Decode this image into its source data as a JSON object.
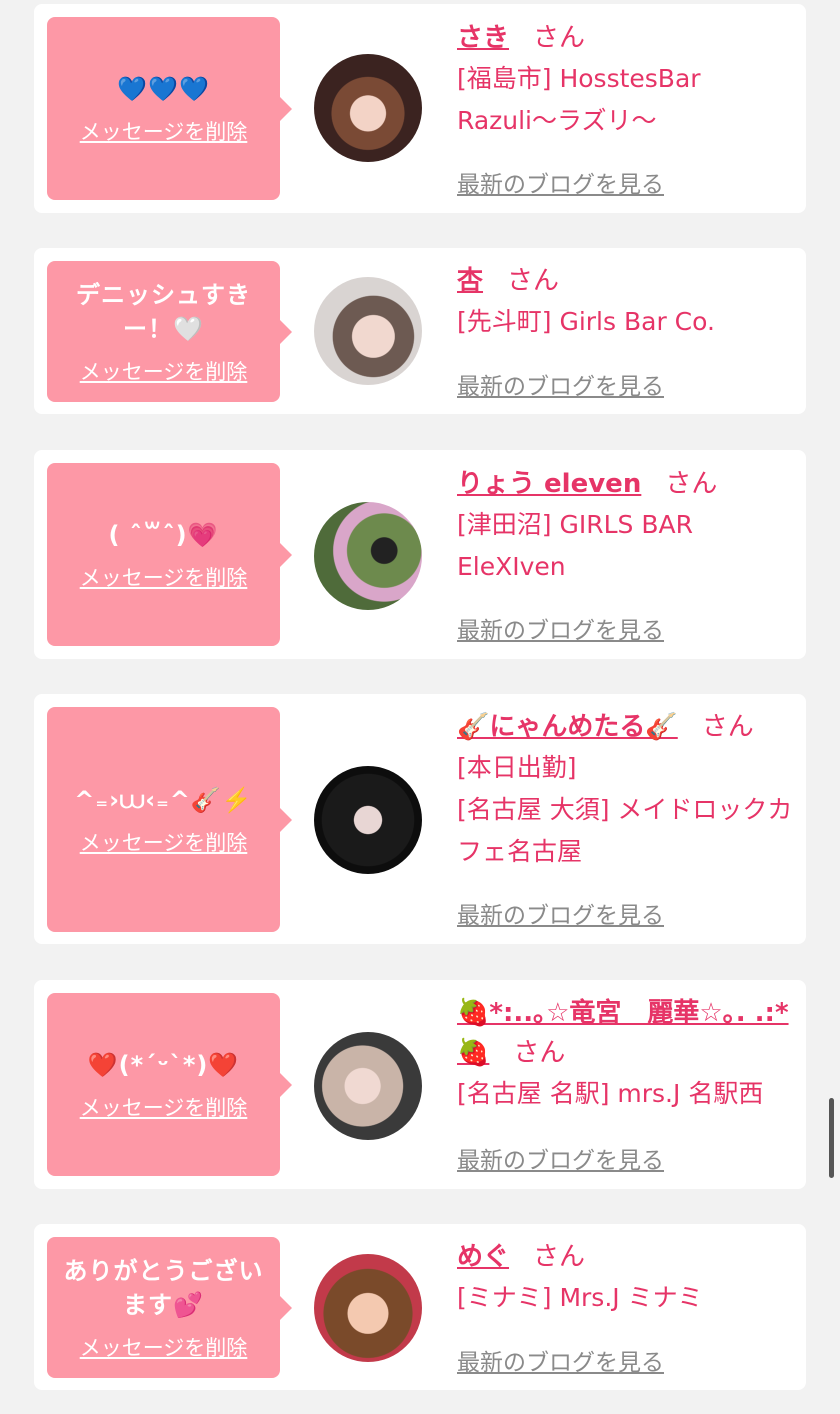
{
  "cards": [
    {
      "message": "💙💙💙",
      "delete_label": "メッセージを削除",
      "name": "さき",
      "san": "さん",
      "shop": "[福島市] HosstesBar Razuli〜ラズリ〜",
      "blog_label": "最新のブログを見る"
    },
    {
      "message": "デニッシュすきー！🤍",
      "delete_label": "メッセージを削除",
      "name": "杏",
      "san": "さん",
      "shop": "[先斗町] Girls Bar Co.",
      "blog_label": "最新のブログを見る"
    },
    {
      "message": "( ˆ꒳ˆ)💗",
      "delete_label": "メッセージを削除",
      "name": "りょう eleven",
      "san": "さん",
      "shop": "[津田沼] GIRLS BAR EleXIven",
      "blog_label": "最新のブログを見る"
    },
    {
      "message": "^₌›⩊‹₌^🎸⚡️",
      "delete_label": "メッセージを削除",
      "name": "🎸にゃんめたる🎸",
      "san": "さん",
      "status": "[本日出勤]",
      "shop": "[名古屋 大須] メイドロックカフェ名古屋",
      "blog_label": "最新のブログを見る"
    },
    {
      "message": "❤️(*´ᵕ`*)❤️",
      "delete_label": "メッセージを削除",
      "name": "🍓*:..｡☆竜宮　麗華☆｡. .:*🍓",
      "san": "さん",
      "shop": "[名古屋 名駅] mrs.J 名駅西",
      "blog_label": "最新のブログを見る"
    },
    {
      "message": "ありがとうございます💕",
      "delete_label": "メッセージを削除",
      "name": "めぐ",
      "san": "さん",
      "shop": "[ミナミ] Mrs.J ミナミ",
      "blog_label": "最新のブログを見る"
    }
  ],
  "colors": {
    "accent": "#e63467",
    "bubble": "#fd98a6",
    "background": "#f2f2f2"
  }
}
